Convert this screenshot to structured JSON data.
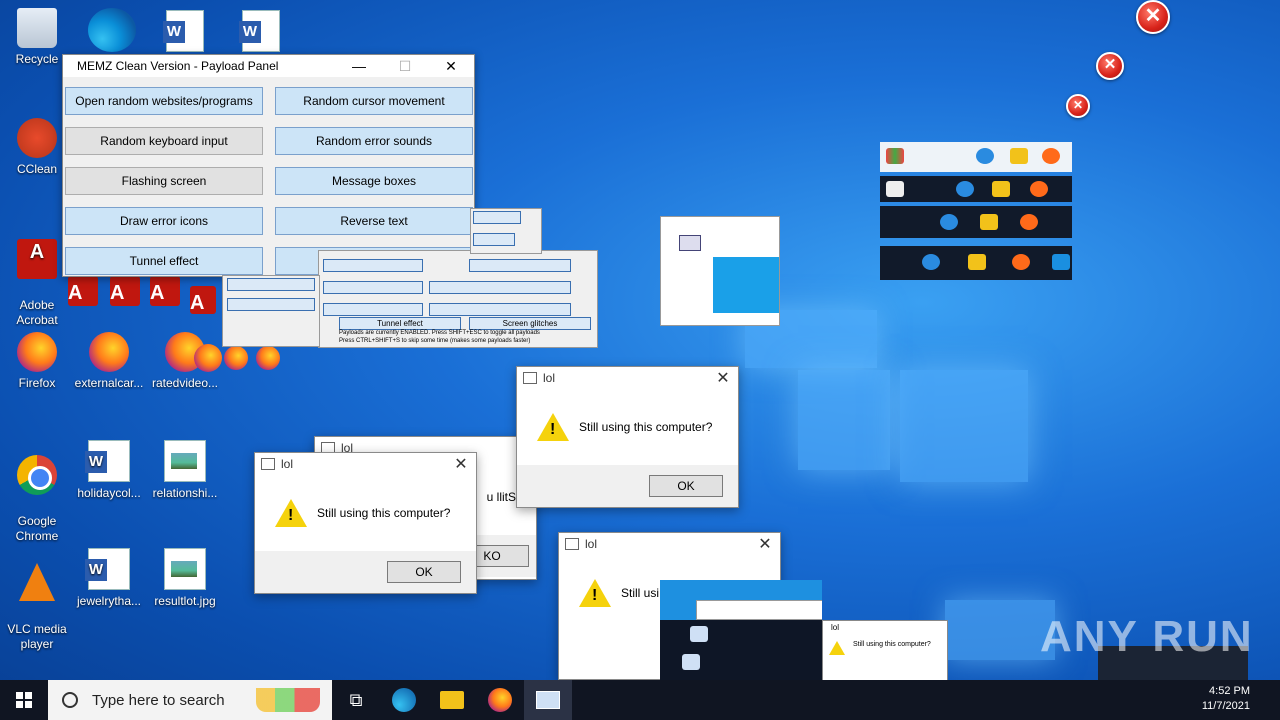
{
  "desktop": {
    "icons": [
      {
        "label": "Recycle"
      },
      {
        "label": "CClean"
      },
      {
        "label": "Adobe\nAcrobat"
      },
      {
        "label": "Firefox"
      },
      {
        "label": "externalcar..."
      },
      {
        "label": "ratedvideo..."
      },
      {
        "label": "Google\nChrome"
      },
      {
        "label": "holidaycol..."
      },
      {
        "label": "relationshi..."
      },
      {
        "label": "VLC media\nplayer"
      },
      {
        "label": "jewelrytha..."
      },
      {
        "label": "resultlot.jpg"
      }
    ]
  },
  "memz": {
    "title": "MEMZ Clean Version - Payload Panel",
    "minimize": "—",
    "maximize": "☐",
    "close": "✕",
    "buttons": [
      {
        "label": "Open random websites/programs",
        "state": "active"
      },
      {
        "label": "Random cursor movement",
        "state": "active"
      },
      {
        "label": "Random keyboard input",
        "state": "inactive"
      },
      {
        "label": "Random error sounds",
        "state": "active"
      },
      {
        "label": "Flashing screen",
        "state": "inactive"
      },
      {
        "label": "Message boxes",
        "state": "active"
      },
      {
        "label": "Draw error icons",
        "state": "active"
      },
      {
        "label": "Reverse text",
        "state": "active"
      },
      {
        "label": "Tunnel effect",
        "state": "active"
      },
      {
        "label": "Screen glitches",
        "state": "active"
      }
    ]
  },
  "ghost_panel": {
    "labels": [
      "Tunnel effect",
      "Screen glitches",
      "Payloads are currently ENABLED. Press SHIFT+ESC to toggle all payloads",
      "Press CTRL+SHIFT+S to skip some time (makes some payloads faster)"
    ]
  },
  "dialogs": [
    {
      "title": "lol",
      "message": "Still using this computer?",
      "ok": "OK"
    },
    {
      "title": "lol",
      "message": "Still using this computer?",
      "ok": "OK"
    },
    {
      "title": "lol",
      "message": "Still usi",
      "ok": ""
    },
    {
      "title": "lol",
      "message": "Still using this computer?",
      "ok": "OK"
    }
  ],
  "ghost_dialog": {
    "title": "lol",
    "message": "u llitS",
    "ok": "KO"
  },
  "mini_dialog": {
    "title": "lol",
    "line1": "Still using this computer?",
    "ok": "OK"
  },
  "taskbar": {
    "search_placeholder": "Type here to search",
    "time": "4:52 PM",
    "date": "11/7/2021"
  },
  "watermark": "ANY RUN",
  "colors": {
    "accent": "#0078d7",
    "button_active": "#cce4f7",
    "button_inactive": "#e1e1e1",
    "taskbar": "#101522"
  }
}
